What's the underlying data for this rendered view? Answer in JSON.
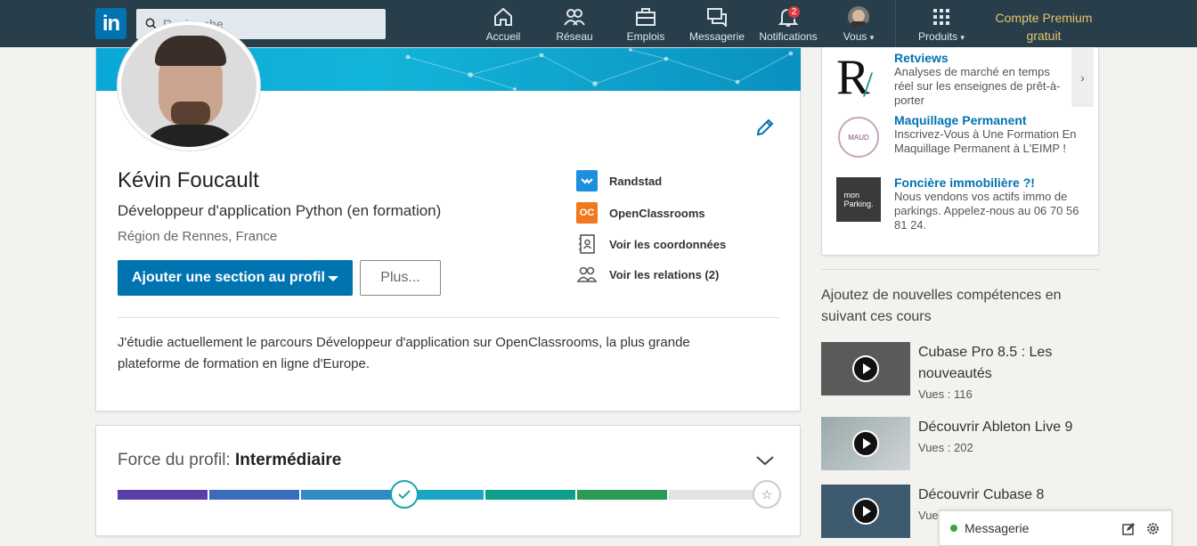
{
  "search": {
    "placeholder": "Recherche"
  },
  "nav": {
    "home": "Accueil",
    "network": "Réseau",
    "jobs": "Emplois",
    "messaging": "Messagerie",
    "notifications": "Notifications",
    "notifications_count": "2",
    "me": "Vous",
    "products": "Produits",
    "premium": "Compte Premium gratuit"
  },
  "profile": {
    "name": "Kévin Foucault",
    "headline": "Développeur d'application Python (en formation)",
    "location": "Région de Rennes, France",
    "add_section": "Ajouter une section au profil",
    "more": "Plus...",
    "side": {
      "company": "Randstad",
      "school": "OpenClassrooms",
      "contact": "Voir les coordonnées",
      "connections": "Voir les relations (2)"
    },
    "summary": "J'étudie actuellement le parcours Développeur d'application sur OpenClassrooms, la plus grande plateforme de formation en ligne d'Europe."
  },
  "strength": {
    "label": "Force du profil:",
    "level": "Intermédiaire",
    "progress": 0.72,
    "colors": [
      "#5b3fa8",
      "#3b6bbd",
      "#2f8ac6",
      "#1aa6c2",
      "#0f9e8a",
      "#2a9a55"
    ]
  },
  "ads": [
    {
      "title": "Retviews",
      "desc": "Analyses de marché en temps réel sur les enseignes de prêt-à-porter",
      "logo": "retviews-logo"
    },
    {
      "title": "Maquillage Permanent",
      "desc": "Inscrivez-Vous à Une Formation En Maquillage Permanent à L'EIMP !",
      "logo": "maud-logo"
    },
    {
      "title": "Foncière immobilière ?!",
      "desc": "Nous vendons vos actifs immo de parkings. Appelez-nous au 06 70 56 81 24.",
      "logo": "parking-logo"
    }
  ],
  "courses": {
    "heading": "Ajoutez de nouvelles compétences en suivant ces cours",
    "items": [
      {
        "title": "Cubase Pro 8.5 : Les nouveautés",
        "views": "Vues : 116"
      },
      {
        "title": "Découvrir Ableton Live 9",
        "views": "Vues : 202"
      },
      {
        "title": "Découvrir Cubase 8",
        "views": "Vue"
      }
    ]
  },
  "messaging": {
    "label": "Messagerie"
  }
}
